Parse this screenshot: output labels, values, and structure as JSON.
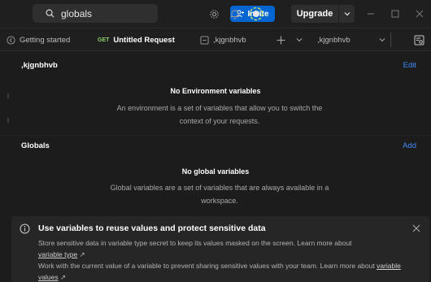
{
  "topbar": {
    "search_value": "globals",
    "invite_label": "Invite",
    "upgrade_label": "Upgrade"
  },
  "tabs": {
    "getting_started": "Getting started",
    "request_method": "GET",
    "request_label": "Untitled Request",
    "environment_tab": ",kjgnbhvb",
    "environment_select": ",kjgnbhvb"
  },
  "environment": {
    "name": ",kjgnbhvb",
    "edit_label": "Edit",
    "empty_title": "No Environment variables",
    "empty_desc": "An environment is a set of variables that allow you to switch the context of your requests."
  },
  "globals": {
    "name": "Globals",
    "add_label": "Add",
    "empty_title": "No global variables",
    "empty_desc": "Global variables are a set of variables that are always available in a workspace."
  },
  "banner": {
    "title": "Use variables to reuse values and protect sensitive data",
    "p1": "Store sensitive data in variable type secret to keep its values masked on the screen. Learn more about",
    "link1": "variable type",
    "p2": "Work with the current value of a variable to prevent sharing sensitive values with your team. Learn more about",
    "link2": "variable values",
    "arrow": "↗"
  },
  "colors": {
    "accent": "#0265d2",
    "link": "#3e8ef7",
    "method_get": "#8bd06a"
  }
}
